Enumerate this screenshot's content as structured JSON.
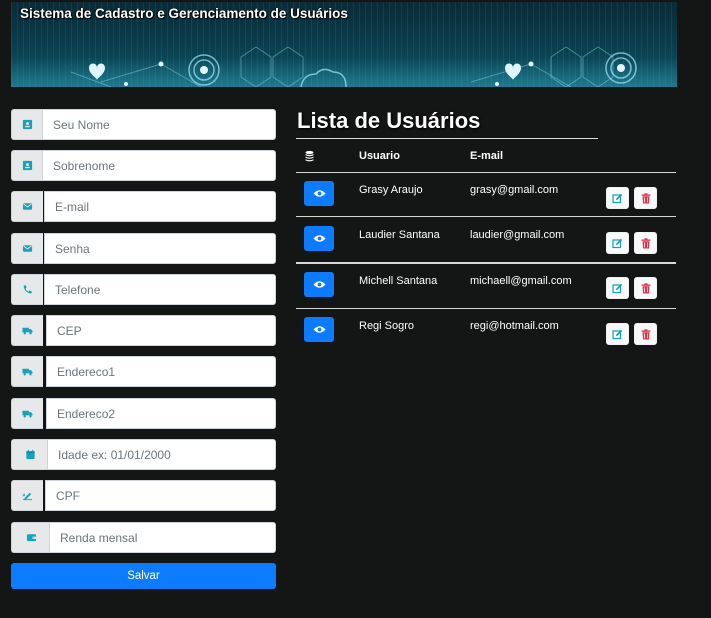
{
  "banner": {
    "title": "Sistema de Cadastro e Gerenciamento de Usuários"
  },
  "form": {
    "fields": [
      {
        "placeholder": "Seu Nome",
        "icon": "id-card-icon"
      },
      {
        "placeholder": "Sobrenome",
        "icon": "id-card-icon"
      },
      {
        "placeholder": "E-mail",
        "icon": "envelope-icon"
      },
      {
        "placeholder": "Senha",
        "icon": "envelope-icon"
      },
      {
        "placeholder": "Telefone",
        "icon": "phone-icon"
      },
      {
        "placeholder": "CEP",
        "icon": "truck-icon"
      },
      {
        "placeholder": "Endereco1",
        "icon": "truck-icon"
      },
      {
        "placeholder": "Endereco2",
        "icon": "truck-icon"
      },
      {
        "placeholder": "Idade ex: 01/01/2000",
        "icon": "calendar-icon"
      },
      {
        "placeholder": "CPF",
        "icon": "signature-icon"
      },
      {
        "placeholder": "Renda mensal",
        "icon": "wallet-icon"
      }
    ],
    "save_label": "Salvar"
  },
  "list": {
    "title": "Lista de Usuários",
    "headers": {
      "icon": "coins-icon",
      "user": "Usuario",
      "email": "E-mail"
    },
    "rows": [
      {
        "name": "Grasy Araujo",
        "email": "grasy@gmail.com"
      },
      {
        "name": "Laudier Santana",
        "email": "laudier@gmail.com"
      },
      {
        "name": "Michell Santana",
        "email": "michaell@gmail.com"
      },
      {
        "name": "Regi Sogro",
        "email": "regi@hotmail.com"
      }
    ]
  },
  "colors": {
    "background": "#141515",
    "primary": "#0d7bfd",
    "addon_icon": "#17a2b8",
    "edit_icon": "#17a2b8",
    "delete_icon": "#dc3545"
  }
}
